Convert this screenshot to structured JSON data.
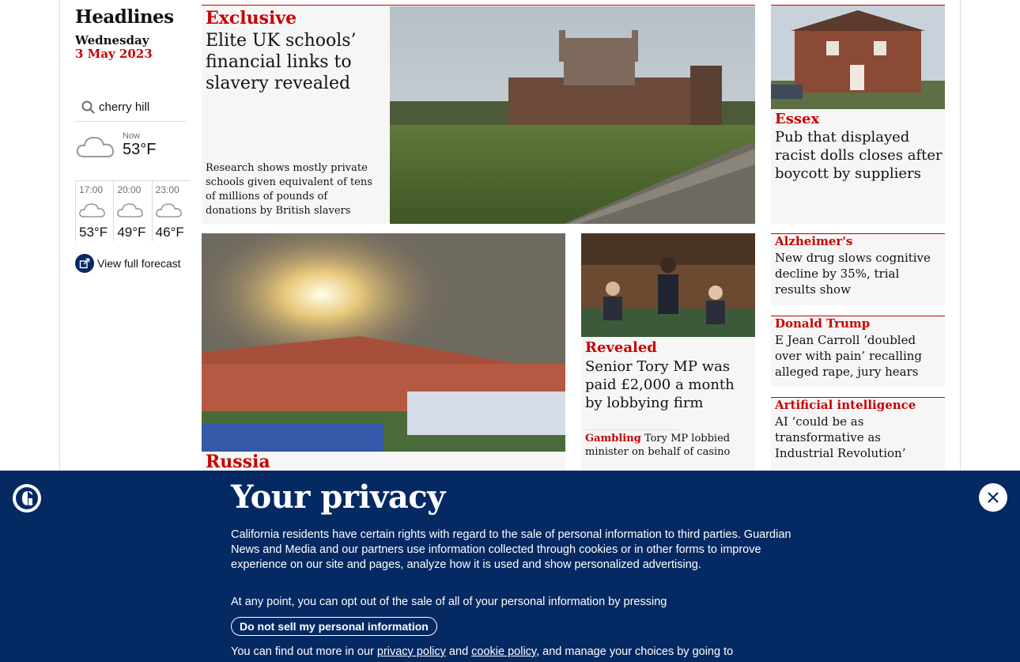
{
  "sidebar": {
    "headlines": "Headlines",
    "day": "Wednesday",
    "date": "3 May 2023",
    "search_value": "cherry hill",
    "now_label": "Now",
    "now_temp": "53°F",
    "forecast": [
      {
        "time": "17:00",
        "temp": "53°F"
      },
      {
        "time": "20:00",
        "temp": "49°F"
      },
      {
        "time": "23:00",
        "temp": "46°F"
      }
    ],
    "full_forecast": "View full forecast"
  },
  "main_story": {
    "kicker": "Exclusive",
    "headline": "Elite UK schools’ financial links to slavery revealed",
    "trail": "Research shows mostly private schools given equivalent of tens of millions of pounds of donations by British slavers"
  },
  "essex_story": {
    "kicker": "Essex",
    "headline": "Pub that displayed racist dolls closes after boycott by suppliers"
  },
  "russia_story": {
    "kicker": "Russia"
  },
  "revealed_story": {
    "kicker": "Revealed",
    "headline": "Senior Tory MP was paid £2,000 a month by lobbying firm",
    "sublink_kicker": "Gambling",
    "sublink_text": "Tory MP lobbied minister on behalf of casino"
  },
  "mini_stories": [
    {
      "kicker": "Alzheimer's",
      "headline": "New drug slows cognitive decline by 35%, trial results show"
    },
    {
      "kicker": "Donald Trump",
      "headline": "E Jean Carroll ‘doubled over with pain’ recalling alleged rape, jury hears"
    },
    {
      "kicker": "Artificial intelligence",
      "headline": "AI ‘could be as transformative as Industrial Revolution’"
    }
  ],
  "privacy": {
    "title": "Your privacy",
    "text1": "California residents have certain rights with regard to the sale of personal information to third parties. Guardian News and Media and our partners use information collected through cookies or in other forms to improve experience on our site and pages, analyze how it is used and show personalized advertising.",
    "text2": "At any point, you can opt out of the sale of all of your personal information by pressing",
    "button": "Do not sell my personal information",
    "text3_start": "You can find out more in our ",
    "privacy_link": "privacy policy",
    "and": " and ",
    "cookie_link": "cookie policy",
    "text3_end": ", and manage your choices by going to"
  },
  "colors": {
    "brand_blue": "#052962",
    "news_red": "#c70000",
    "card_bg": "#f6f6f6"
  }
}
